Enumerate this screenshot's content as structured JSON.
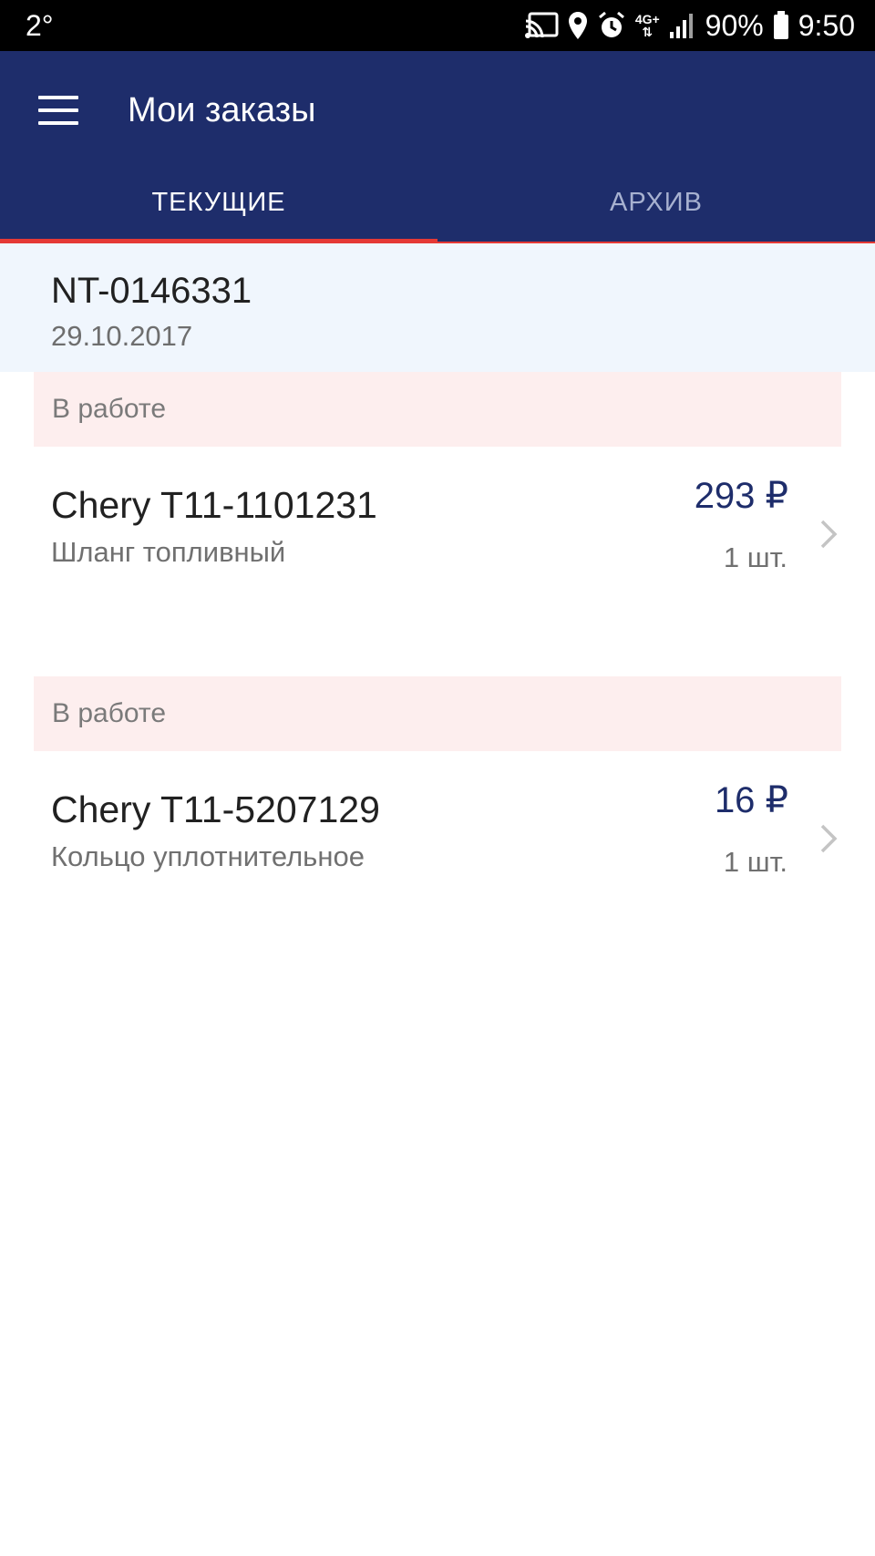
{
  "status_bar": {
    "temperature": "2°",
    "network": "4G+",
    "battery": "90%",
    "time": "9:50"
  },
  "appbar": {
    "title": "Мои заказы"
  },
  "tabs": [
    {
      "label": "ТЕКУЩИЕ",
      "selected": true
    },
    {
      "label": "АРХИВ",
      "selected": false
    }
  ],
  "order": {
    "number": "NT-0146331",
    "date": "29.10.2017",
    "items": [
      {
        "status": "В работе",
        "name": "Chery T11-1101231",
        "description": "Шланг топливный",
        "price": "293 ₽",
        "quantity": "1 шт."
      },
      {
        "status": "В работе",
        "name": "Chery T11-5207129",
        "description": "Кольцо уплотнительное",
        "price": "16 ₽",
        "quantity": "1 шт."
      }
    ]
  },
  "colors": {
    "appbar": "#1e2d6b",
    "accent": "#e53935",
    "order_header_bg": "#f0f6fd",
    "status_band_bg": "#fdeeee"
  },
  "icons": [
    "menu-icon",
    "cast-icon",
    "location-icon",
    "alarm-icon",
    "signal-icon",
    "battery-icon",
    "chevron-right-icon"
  ]
}
